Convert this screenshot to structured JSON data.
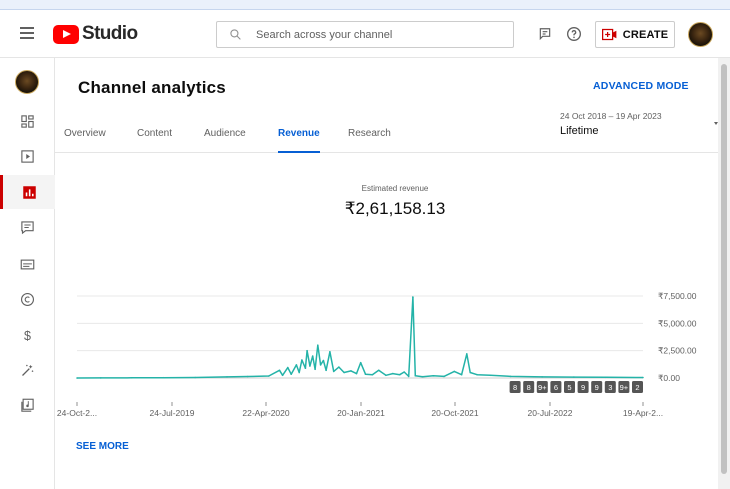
{
  "app": {
    "name": "Studio"
  },
  "search": {
    "placeholder": "Search across your channel"
  },
  "header": {
    "create_label": "CREATE"
  },
  "page": {
    "title": "Channel analytics",
    "advanced_mode": "ADVANCED MODE"
  },
  "date": {
    "range": "24 Oct 2018 – 19 Apr 2023",
    "period": "Lifetime"
  },
  "tabs": [
    {
      "label": "Overview"
    },
    {
      "label": "Content"
    },
    {
      "label": "Audience"
    },
    {
      "label": "Revenue",
      "active": true
    },
    {
      "label": "Research"
    }
  ],
  "sidebar": {
    "items": [
      {
        "icon": "dashboard-icon"
      },
      {
        "icon": "content-icon"
      },
      {
        "icon": "analytics-icon",
        "active": true
      },
      {
        "icon": "comments-icon"
      },
      {
        "icon": "subtitles-icon"
      },
      {
        "icon": "copyright-icon"
      },
      {
        "icon": "earn-icon"
      },
      {
        "icon": "customisation-icon"
      },
      {
        "icon": "audio-library-icon"
      }
    ]
  },
  "metric": {
    "label": "Estimated revenue",
    "value": "₹2,61,158.13"
  },
  "see_more": "SEE MORE",
  "colors": {
    "accent": "#065fd4",
    "series": "#24b3a8",
    "brand": "#ff0000",
    "active_nav": "#cc0000"
  },
  "chart_data": {
    "type": "line",
    "title": "Estimated revenue",
    "x_tick_labels": [
      "24-Oct-2...",
      "24-Jul-2019",
      "22-Apr-2020",
      "20-Jan-2021",
      "20-Oct-2021",
      "20-Jul-2022",
      "19-Apr-2..."
    ],
    "x_start": "2018-10-24",
    "x_end": "2023-04-19",
    "y_tick_labels": [
      "₹7,500.00",
      "₹5,000.00",
      "₹2,500.00",
      "₹0.00"
    ],
    "y_ticks": [
      7500,
      5000,
      2500,
      0
    ],
    "ylim": [
      0,
      7500
    ],
    "grid": true,
    "series": [
      {
        "values": [
          [
            "2018-10-24",
            0
          ],
          [
            "2019-01-01",
            10
          ],
          [
            "2019-04-01",
            20
          ],
          [
            "2019-07-01",
            30
          ],
          [
            "2019-10-01",
            50
          ],
          [
            "2020-01-01",
            100
          ],
          [
            "2020-03-01",
            140
          ],
          [
            "2020-05-01",
            180
          ],
          [
            "2020-06-01",
            700
          ],
          [
            "2020-06-10",
            250
          ],
          [
            "2020-06-25",
            950
          ],
          [
            "2020-07-05",
            350
          ],
          [
            "2020-07-20",
            1200
          ],
          [
            "2020-07-28",
            500
          ],
          [
            "2020-08-05",
            1650
          ],
          [
            "2020-08-15",
            900
          ],
          [
            "2020-08-20",
            2500
          ],
          [
            "2020-08-28",
            1100
          ],
          [
            "2020-09-05",
            2000
          ],
          [
            "2020-09-12",
            800
          ],
          [
            "2020-09-20",
            3000
          ],
          [
            "2020-09-28",
            1200
          ],
          [
            "2020-10-06",
            1600
          ],
          [
            "2020-10-14",
            700
          ],
          [
            "2020-10-25",
            2400
          ],
          [
            "2020-11-05",
            600
          ],
          [
            "2020-11-20",
            1000
          ],
          [
            "2020-12-05",
            500
          ],
          [
            "2020-12-25",
            650
          ],
          [
            "2021-01-10",
            400
          ],
          [
            "2021-01-22",
            1400
          ],
          [
            "2021-02-05",
            350
          ],
          [
            "2021-02-25",
            300
          ],
          [
            "2021-03-15",
            700
          ],
          [
            "2021-04-05",
            250
          ],
          [
            "2021-04-25",
            400
          ],
          [
            "2021-05-15",
            300
          ],
          [
            "2021-05-28",
            550
          ],
          [
            "2021-06-10",
            150
          ],
          [
            "2021-06-22",
            7400
          ],
          [
            "2021-06-29",
            200
          ],
          [
            "2021-07-20",
            120
          ],
          [
            "2021-08-20",
            200
          ],
          [
            "2021-09-20",
            150
          ],
          [
            "2021-10-20",
            600
          ],
          [
            "2021-11-10",
            300
          ],
          [
            "2021-11-25",
            2200
          ],
          [
            "2021-12-05",
            500
          ],
          [
            "2021-12-25",
            300
          ],
          [
            "2022-02-01",
            250
          ],
          [
            "2022-04-01",
            150
          ],
          [
            "2022-07-01",
            100
          ],
          [
            "2022-10-01",
            80
          ],
          [
            "2023-01-01",
            60
          ],
          [
            "2023-04-19",
            50
          ]
        ]
      }
    ],
    "annotations": [
      "8",
      "8",
      "9+",
      "6",
      "5",
      "9",
      "9",
      "3",
      "9+",
      "2"
    ]
  }
}
